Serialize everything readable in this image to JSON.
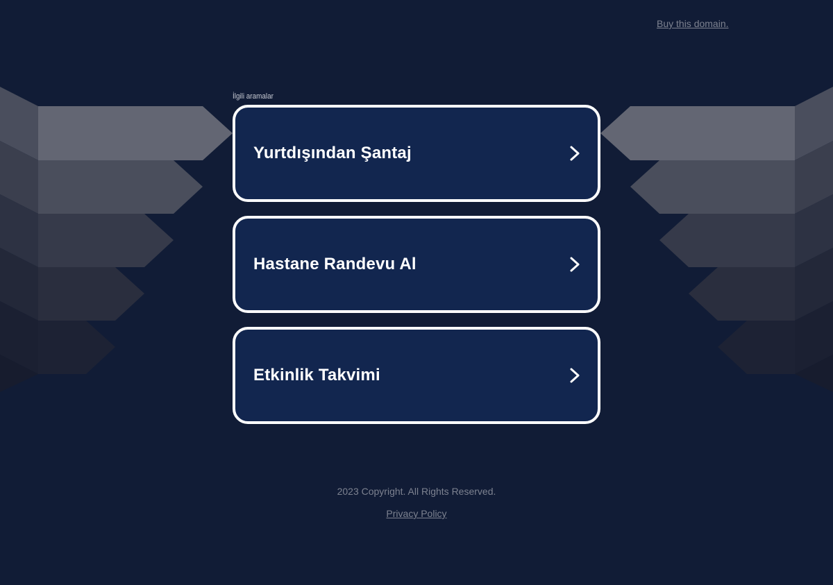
{
  "header": {
    "buy_domain_label": "Buy this domain."
  },
  "related": {
    "label": "İlgili aramalar",
    "items": [
      {
        "label": "Yurtdışından Şantaj"
      },
      {
        "label": "Hastane Randevu Al"
      },
      {
        "label": "Etkinlik Takvimi"
      }
    ]
  },
  "footer": {
    "copyright": "2023 Copyright. All Rights Reserved.",
    "privacy_label": "Privacy Policy "
  },
  "icons": {
    "card_arrow": "chevron-right-icon"
  },
  "colors": {
    "background": "#111c36",
    "card_background": "#12264f",
    "card_border": "#ffffff",
    "link_text": "#7d8290"
  }
}
